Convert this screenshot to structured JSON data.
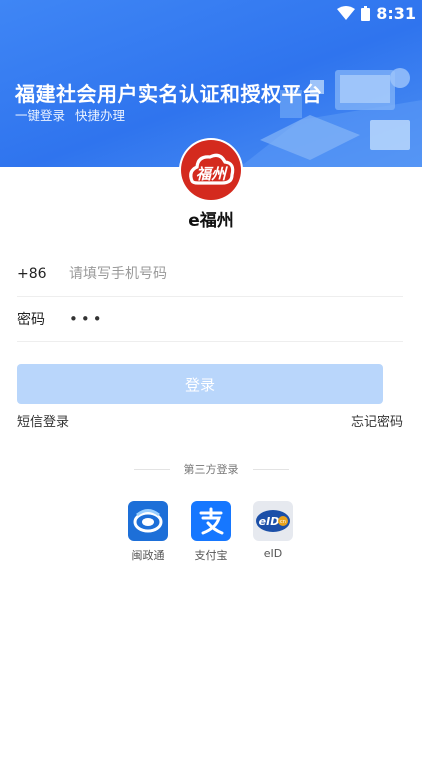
{
  "status_bar": {
    "time": "8:31"
  },
  "header": {
    "title": "福建社会用户实名认证和授权平台",
    "subtitle_1": "一键登录",
    "subtitle_2": "快捷办理"
  },
  "app": {
    "logo_text": "福州",
    "name": "e福州"
  },
  "form": {
    "country_code": "+86",
    "phone_placeholder": "请填写手机号码",
    "password_label": "密码",
    "password_value": "•••"
  },
  "login_button": "登录",
  "links": {
    "sms_login": "短信登录",
    "forgot_password": "忘记密码"
  },
  "third_party": {
    "title": "第三方登录",
    "items": [
      {
        "label": "闽政通",
        "icon": "minzhengtong-icon",
        "color": "#1d6fd8"
      },
      {
        "label": "支付宝",
        "icon": "alipay-icon",
        "color": "#1677ff"
      },
      {
        "label": "eID",
        "icon": "eid-icon",
        "color": "#1b4fa8"
      }
    ]
  },
  "colors": {
    "primary": "#2f74ee",
    "button_disabled": "#b9d6fb",
    "logo_red": "#d42a1e"
  }
}
